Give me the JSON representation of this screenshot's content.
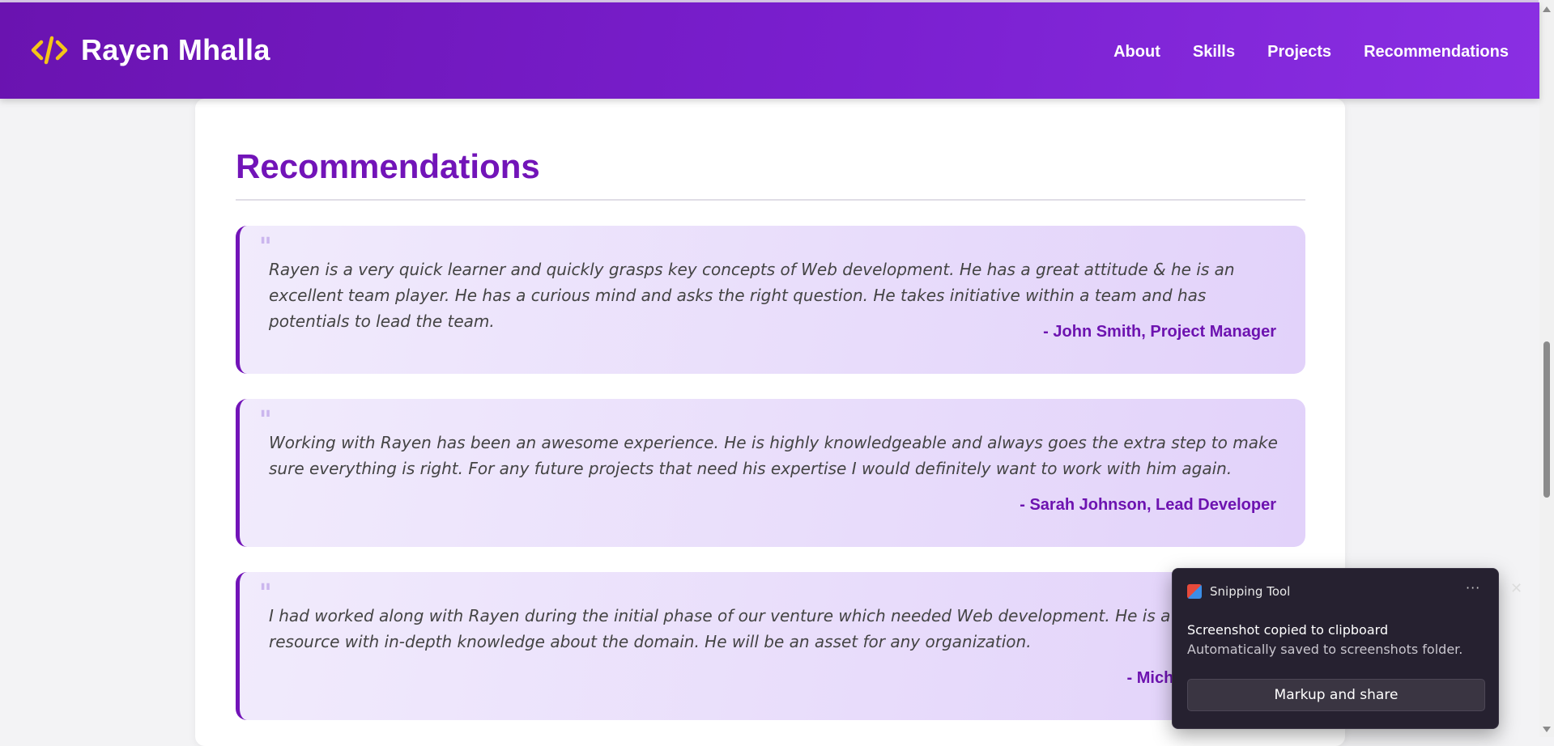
{
  "header": {
    "brand_icon": "code-icon",
    "brand_name": "Rayen Mhalla",
    "nav": [
      "About",
      "Skills",
      "Projects",
      "Recommendations"
    ]
  },
  "main": {
    "section_title": "Recommendations",
    "recommendations": [
      {
        "text": "Rayen is a very quick learner and quickly grasps key concepts of Web development. He has a great attitude & he is an excellent team player. He has a curious mind and asks the right question. He takes initiative within a team and has potentials to lead the team.",
        "author": "- John Smith, Project Manager"
      },
      {
        "text": "Working with Rayen has been an awesome experience. He is highly knowledgeable and always goes the extra step to make sure everything is right. For any future projects that need his expertise I would definitely want to work with him again.",
        "author": "- Sarah Johnson, Lead Developer"
      },
      {
        "text": "I had worked along with Rayen during the initial phase of our venture which needed Web development. He is a committed resource with in-depth knowledge about the domain. He will be an asset for any organization.",
        "author": "- Michael Brown, St"
      }
    ]
  },
  "toast": {
    "app_name": "Snipping Tool",
    "more_icon": "more-icon",
    "close_icon": "close-icon",
    "message": "Screenshot copied to clipboard",
    "sub_message": "Automatically saved to screenshots folder.",
    "button_label": "Markup and share"
  },
  "colors": {
    "header_gradient_start": "#6a13b0",
    "header_gradient_end": "#8a2fe3",
    "accent": "#7214b8",
    "brand_icon": "#f5c518"
  }
}
